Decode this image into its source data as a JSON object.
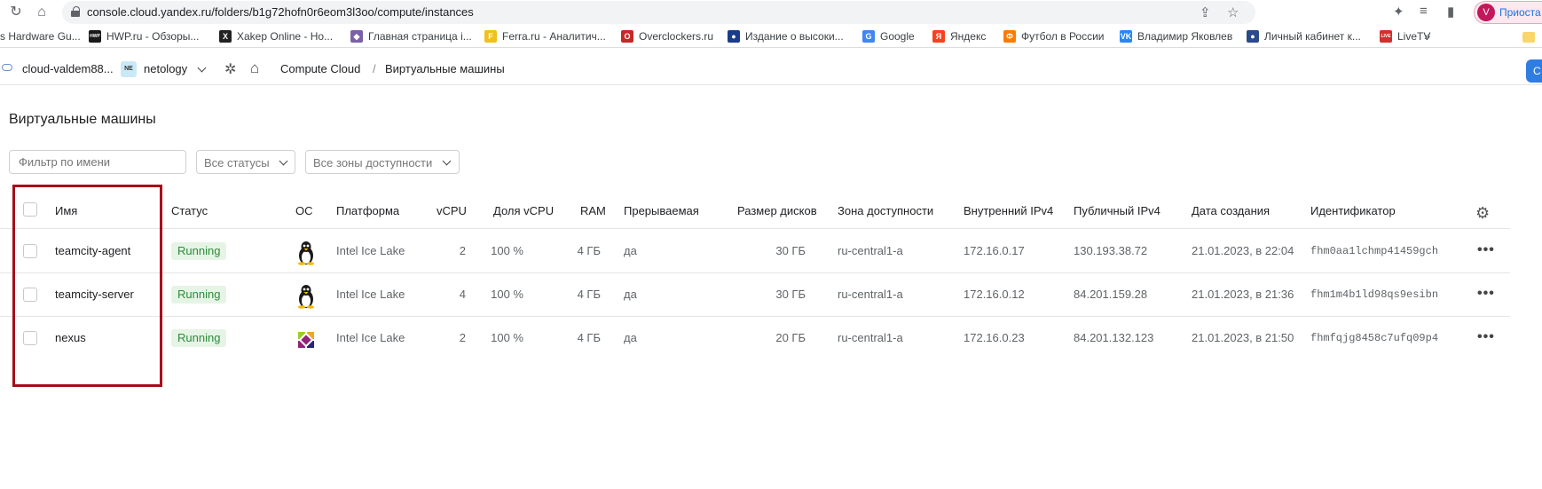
{
  "browser": {
    "url": "console.cloud.yandex.ru/folders/b1g72hofn0r6eom3l3oo/compute/instances",
    "profile_label": "Приоста",
    "profile_initial": "V",
    "bookmarks": [
      {
        "label": "s Hardware Gu...",
        "icon": "none",
        "color": "#ffffff"
      },
      {
        "label": "HWP.ru - Обзоры...",
        "icon": "HWP",
        "color": "#1a1a1a"
      },
      {
        "label": "Xakep Online - Но...",
        "icon": "X",
        "color": "#222222"
      },
      {
        "label": "Главная страница i...",
        "icon": "◆",
        "color": "#7b61a8"
      },
      {
        "label": "Ferra.ru - Аналитич...",
        "icon": "F",
        "color": "#f0c11a"
      },
      {
        "label": "Overclockers.ru",
        "icon": "O",
        "color": "#c62828"
      },
      {
        "label": "Издание о высоки...",
        "icon": "●",
        "color": "#1a3c8c"
      },
      {
        "label": "Google",
        "icon": "G",
        "color": "#4285f4"
      },
      {
        "label": "Яндекс",
        "icon": "Я",
        "color": "#fc3f1d"
      },
      {
        "label": "Футбол в России",
        "icon": "Ф",
        "color": "#ff7a00"
      },
      {
        "label": "Владимир Яковлев",
        "icon": "VK",
        "color": "#2787f5"
      },
      {
        "label": "Личный кабинет к...",
        "icon": "●",
        "color": "#2b4a8c"
      },
      {
        "label": "LiveTV",
        "icon": "LIVE",
        "color": "#d32f2f"
      }
    ],
    "bookmarks_more": "»"
  },
  "console": {
    "cloud": "cloud-valdem88...",
    "folder_badge": "NE",
    "folder": "netology",
    "service": "Compute Cloud",
    "separator": "/",
    "section": "Виртуальные машины",
    "primary_button": "С"
  },
  "page": {
    "title": "Виртуальные машины",
    "filter_placeholder": "Фильтр по имени",
    "status_filter": "Все статусы",
    "zone_filter": "Все зоны доступности"
  },
  "table": {
    "columns": {
      "name": "Имя",
      "status": "Статус",
      "os": "ОС",
      "platform": "Платформа",
      "vcpu": "vCPU",
      "vcpu_share": "Доля vCPU",
      "ram": "RAM",
      "preemptible": "Прерываемая",
      "disk_size": "Размер дисков",
      "zone": "Зона доступности",
      "internal_ip": "Внутренний IPv4",
      "public_ip": "Публичный IPv4",
      "created": "Дата создания",
      "id": "Идентификатор"
    },
    "rows": [
      {
        "name": "teamcity-agent",
        "status": "Running",
        "os_icon": "linux-tux-icon",
        "platform": "Intel Ice Lake",
        "vcpu": "2",
        "vcpu_share": "100 %",
        "ram": "4 ГБ",
        "preemptible": "да",
        "disk_size": "30 ГБ",
        "zone": "ru-central1-a",
        "internal_ip": "172.16.0.17",
        "public_ip": "130.193.38.72",
        "created": "21.01.2023, в 22:04",
        "id": "fhm0aa1lchmp41459gch"
      },
      {
        "name": "teamcity-server",
        "status": "Running",
        "os_icon": "linux-tux-icon",
        "platform": "Intel Ice Lake",
        "vcpu": "4",
        "vcpu_share": "100 %",
        "ram": "4 ГБ",
        "preemptible": "да",
        "disk_size": "30 ГБ",
        "zone": "ru-central1-a",
        "internal_ip": "172.16.0.12",
        "public_ip": "84.201.159.28",
        "created": "21.01.2023, в 21:36",
        "id": "fhm1m4b1ld98qs9esibn"
      },
      {
        "name": "nexus",
        "status": "Running",
        "os_icon": "centos-icon",
        "platform": "Intel Ice Lake",
        "vcpu": "2",
        "vcpu_share": "100 %",
        "ram": "4 ГБ",
        "preemptible": "да",
        "disk_size": "20 ГБ",
        "zone": "ru-central1-a",
        "internal_ip": "172.16.0.23",
        "public_ip": "84.201.132.123",
        "created": "21.01.2023, в 21:50",
        "id": "fhmfqjg8458c7ufq09p4"
      }
    ],
    "row_menu": "•••"
  },
  "colors": {
    "running_bg": "#e6f4e6",
    "running_text": "#2e8b3a",
    "highlight_frame": "#a50e1b"
  }
}
